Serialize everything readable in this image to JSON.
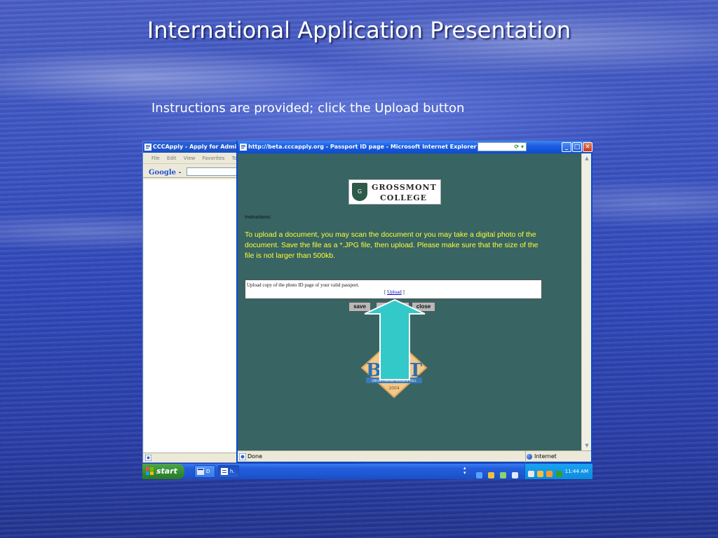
{
  "slide": {
    "title": "International Application Presentation",
    "subtitle": "Instructions are provided; click the Upload button"
  },
  "background_window": {
    "title": "CCCApply - Apply for Admission",
    "menu": [
      "File",
      "Edit",
      "View",
      "Favorites",
      "Tools"
    ],
    "toolbar_google": "Google -"
  },
  "ie_window": {
    "title": "http://beta.cccapply.org - Passport ID page - Microsoft Internet Explorer",
    "status_text": "Done",
    "status_zone": "Internet"
  },
  "page": {
    "logo_line1": "GROSSMONT",
    "logo_line2": "COLLEGE",
    "instructions_label": "Instructions:",
    "instructions_text": "To upload a document, you may scan the document or you may take a digital photo of the document. Save the file as a *.JPG file, then upload. Please make sure that the size of the file is not larger than 500kb.",
    "upload_description": "Upload copy of the photo ID page of your valid passport.",
    "upload_bracket_open": "[",
    "upload_link": "Upload",
    "upload_bracket_close": "]",
    "buttons": {
      "save": "save",
      "close": "close"
    },
    "badge_text": "BEST",
    "badge_subtext": "UNION-TRIBUNE READERS POLL",
    "badge_year": "2004"
  },
  "taskbar": {
    "start_label": "start",
    "items": [
      "D",
      "h."
    ],
    "clock": "11:44 AM"
  },
  "colors": {
    "page_bg": "#386464",
    "instructions_text": "#ffff33",
    "arrow_fill": "#33c9c9",
    "xp_blue": "#245edb",
    "start_green": "#318a31"
  }
}
